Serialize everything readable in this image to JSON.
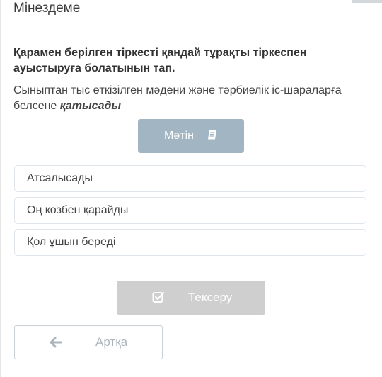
{
  "page": {
    "title": "Мінездеме"
  },
  "question": {
    "prompt": "Қарамен берілген тіркесті қандай тұрақты тіркеспен ауыстыруға болатынын тап.",
    "sentence_main": "Сыныптан тыс өткізілген мәдени және тәрбиелік іс-шараларға белсене ",
    "sentence_highlight": "қатысады"
  },
  "text_button": {
    "label": "Мәтін",
    "icon": "book-icon"
  },
  "options": [
    {
      "label": "Атсалысады"
    },
    {
      "label": "Оң көзбен қарайды"
    },
    {
      "label": "Қол ұшын береді"
    }
  ],
  "check_button": {
    "label": "Тексеру",
    "icon": "check-square-icon"
  },
  "back_button": {
    "label": "Артқа",
    "icon": "arrow-left-icon"
  },
  "colors": {
    "text_button_bg": "#a1b5c3",
    "check_button_bg": "#cfcfcf",
    "option_border": "#dfe5ea"
  }
}
